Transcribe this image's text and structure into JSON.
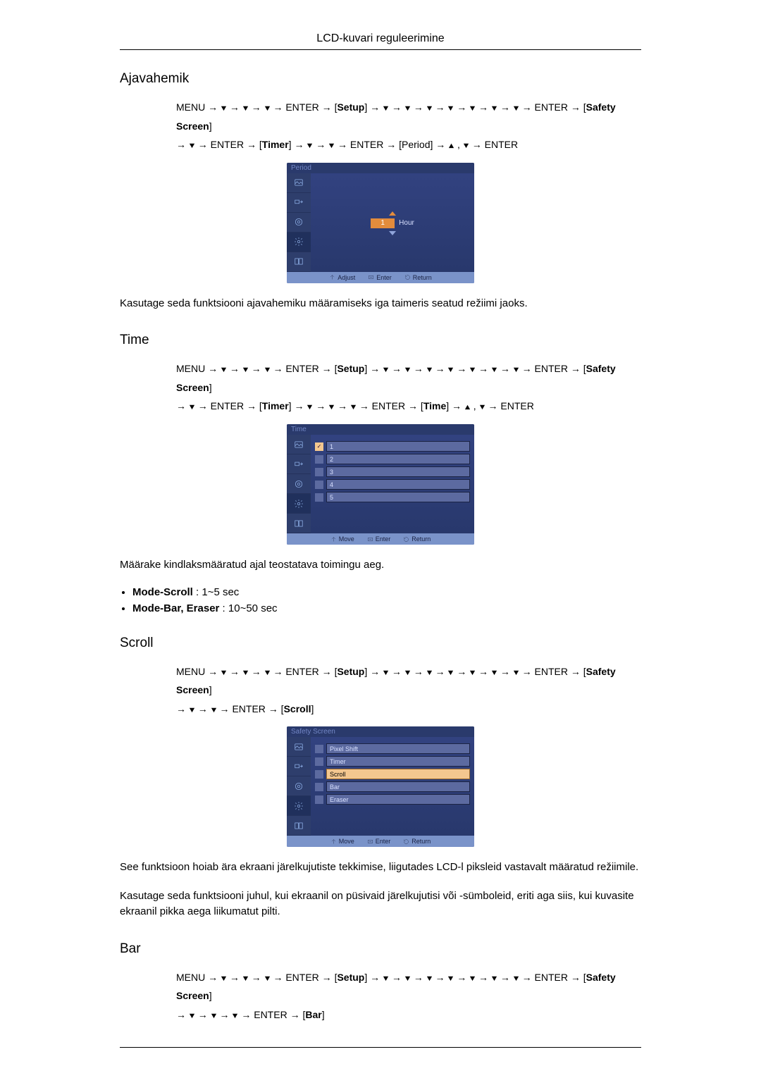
{
  "header": {
    "title": "LCD-kuvari reguleerimine"
  },
  "nav_tokens": {
    "menu": "MENU",
    "enter": "ENTER",
    "setup": "Setup",
    "safety": "Safety Screen",
    "timer": "Timer",
    "period_tag": "Period",
    "time_tag": "Time",
    "scroll_tag": "Scroll",
    "bar_tag": "Bar"
  },
  "sections": {
    "period": {
      "heading": "Ajavahemik",
      "description": "Kasutage seda funktsiooni ajavahemiku määramiseks iga taimeris seatud režiimi jaoks."
    },
    "time": {
      "heading": "Time",
      "description": "Määrake kindlaksmääratud ajal teostatava toimingu aeg.",
      "modes": [
        {
          "label": "Mode-Scroll",
          "range": "1~5 sec"
        },
        {
          "label": "Mode-Bar, Eraser",
          "range": "10~50 sec"
        }
      ]
    },
    "scroll": {
      "heading": "Scroll",
      "description1": "See funktsioon hoiab ära ekraani järelkujutiste tekkimise, liigutades LCD-l piksleid vastavalt määratud režiimile.",
      "description2": "Kasutage seda funktsiooni juhul, kui ekraanil on püsivaid järelkujutisi või -sümboleid, eriti aga siis, kui kuvasite ekraanil pikka aega liikumatut pilti."
    },
    "bar": {
      "heading": "Bar"
    }
  },
  "osd": {
    "period": {
      "title": "Period",
      "value": "1",
      "unit": "Hour",
      "footer": {
        "a": "Adjust",
        "b": "Enter",
        "c": "Return"
      }
    },
    "time": {
      "title": "Time",
      "items": [
        "1",
        "2",
        "3",
        "4",
        "5"
      ],
      "selected_index": 0,
      "footer": {
        "a": "Move",
        "b": "Enter",
        "c": "Return"
      }
    },
    "scroll": {
      "title": "Safety Screen",
      "items": [
        "Pixel Shift",
        "Timer",
        "Scroll",
        "Bar",
        "Eraser"
      ],
      "selected_index": 2,
      "footer": {
        "a": "Move",
        "b": "Enter",
        "c": "Return"
      }
    }
  }
}
